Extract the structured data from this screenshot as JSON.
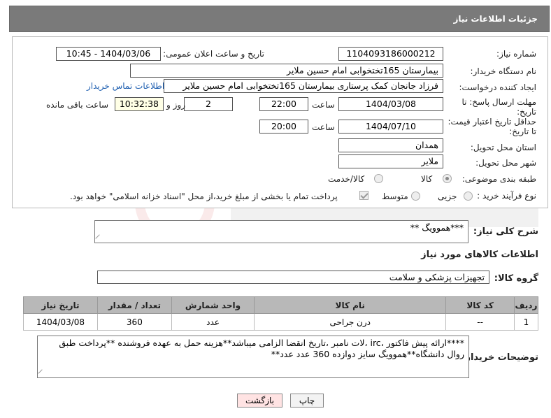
{
  "header": {
    "title": "جزئیات اطلاعات نیاز"
  },
  "fields": {
    "need_number_label": "شماره نیاز:",
    "need_number": "1104093186000212",
    "announce_label": "تاریخ و ساعت اعلان عمومی:",
    "announce_value": "1404/03/06 - 10:45",
    "buyer_org_label": "نام دستگاه خریدار:",
    "buyer_org": "بیمارستان 165تختخوابی امام حسین ملایر",
    "creator_label": "ایجاد کننده درخواست:",
    "creator": "فرزاد جانجان کمک پرستاری بیمارستان 165تختخوابی امام حسین ملایر",
    "contact_link": "اطلاعات تماس خریدار",
    "deadline_label_1": "مهلت ارسال پاسخ: تا",
    "deadline_label_2": "تاریخ:",
    "deadline_date": "1404/03/08",
    "time_label": "ساعت",
    "deadline_time": "22:00",
    "days_value": "2",
    "days_label": "روز و",
    "remaining_time": "10:32:38",
    "remaining_label": "ساعت باقی مانده",
    "validity_label_1": "حداقل تاریخ اعتبار قیمت:",
    "validity_label_2": "تا تاریخ:",
    "validity_date": "1404/07/10",
    "validity_time": "20:00",
    "province_label": "استان محل تحویل:",
    "province": "همدان",
    "city_label": "شهر محل تحویل:",
    "city": "ملایر",
    "category_label": "طبقه بندی موضوعی:",
    "category_options": [
      "کالا",
      "کالا/خدمت"
    ],
    "process_label": "نوع فرآیند خرید :",
    "process_options": [
      "جزیی",
      "متوسط"
    ],
    "payment_note": "پرداخت تمام یا بخشی از مبلغ خرید،از محل \"اسناد خزانه اسلامی\" خواهد بود."
  },
  "description": {
    "label": "شرح کلی نیاز:",
    "value": "***هموویگ **"
  },
  "goods_section": {
    "title": "اطلاعات کالاهای مورد نیاز",
    "group_label": "گروه کالا:",
    "group_value": "تجهیزات پزشکی و سلامت"
  },
  "table": {
    "headers": [
      "ردیف",
      "کد کالا",
      "نام کالا",
      "واحد شمارش",
      "تعداد / مقدار",
      "تاریخ نیاز"
    ],
    "rows": [
      [
        "1",
        "--",
        "درن جراحی",
        "عدد",
        "360",
        "1404/03/08"
      ]
    ]
  },
  "buyer_notes": {
    "label": "توضیحات خریدار:",
    "value": "****ارائه پیش فاکتور ،irc ،لات نامبر ،تاریخ انقضا الزامی میباشد**هزینه حمل به عهده فروشنده **پرداخت طبق روال دانشگاه**هموویگ سایز دوازده 360 عدد عدد**"
  },
  "buttons": {
    "print": "چاپ",
    "back": "بازگشت"
  }
}
